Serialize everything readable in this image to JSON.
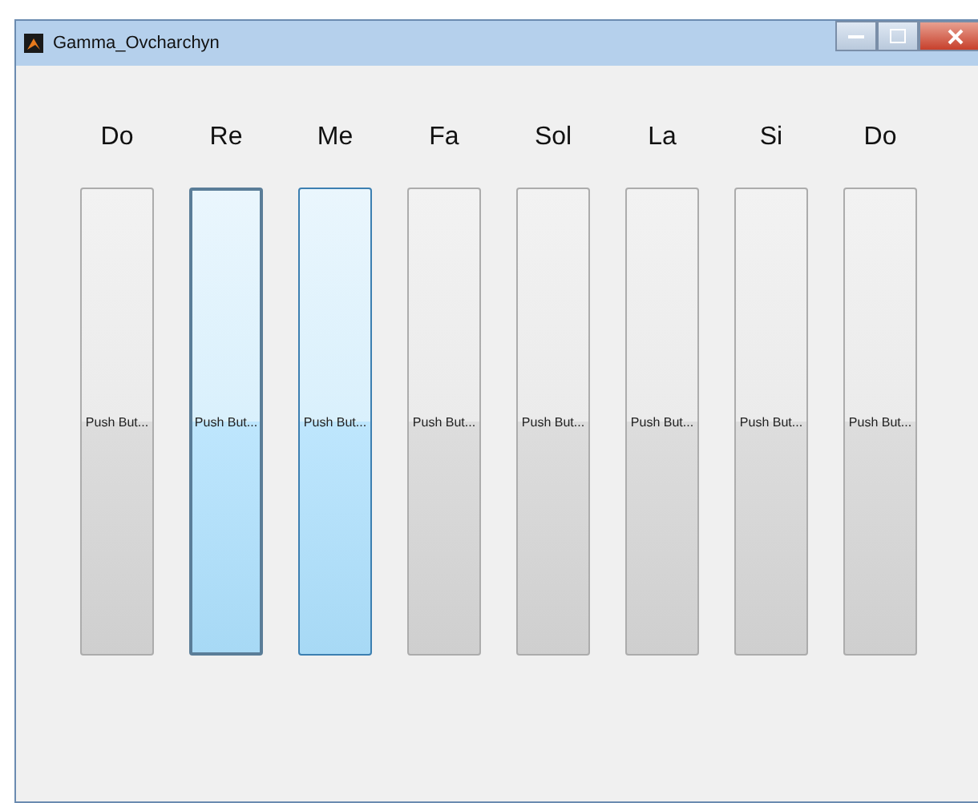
{
  "window": {
    "title": "Gamma_Ovcharchyn"
  },
  "keys": [
    {
      "note": "Do",
      "button": "Push But...",
      "pressed": false,
      "hovered": false
    },
    {
      "note": "Re",
      "button": "Push But...",
      "pressed": true,
      "hovered": true
    },
    {
      "note": "Me",
      "button": "Push But...",
      "pressed": false,
      "hovered": true
    },
    {
      "note": "Fa",
      "button": "Push But...",
      "pressed": false,
      "hovered": false
    },
    {
      "note": "Sol",
      "button": "Push But...",
      "pressed": false,
      "hovered": false
    },
    {
      "note": "La",
      "button": "Push But...",
      "pressed": false,
      "hovered": false
    },
    {
      "note": "Si",
      "button": "Push But...",
      "pressed": false,
      "hovered": false
    },
    {
      "note": "Do",
      "button": "Push But...",
      "pressed": false,
      "hovered": false
    }
  ]
}
